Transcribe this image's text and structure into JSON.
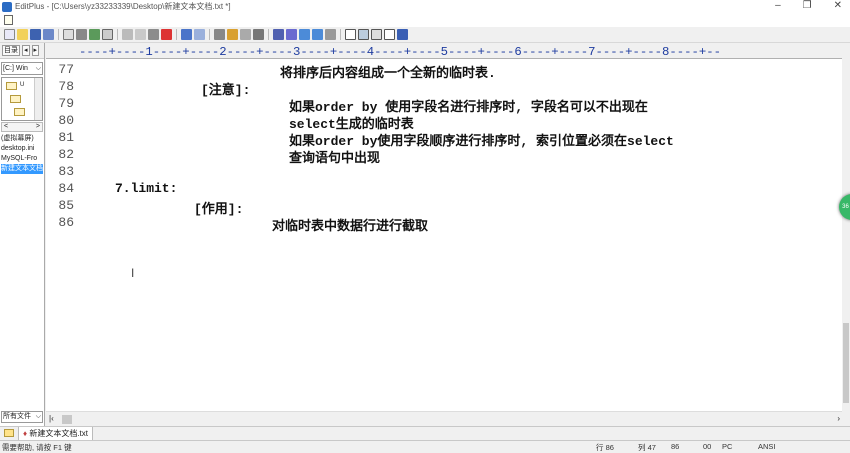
{
  "window": {
    "title": "EditPlus - [C:\\Users\\yz33233339\\Desktop\\新建文本文档.txt *]",
    "minimize": "–",
    "maximize": "❐",
    "close": "✕"
  },
  "sidebar": {
    "tab_label": "目录",
    "tab_prev": "◂",
    "tab_next": "▸",
    "drive": "[C:] Win",
    "tree_items": [
      "U",
      "",
      ""
    ],
    "scroll_left": "<",
    "scroll_right": ">",
    "files": [
      "(虚拟幕屏)",
      "desktop.ini",
      "MySQL-Fro",
      "新建文本文档"
    ],
    "filter": "所有文件"
  },
  "ruler": {
    "text": "----+----1----+----2----+----3----+----4----+----5----+----6----+----7----+----8----+--"
  },
  "editor": {
    "lines": [
      {
        "num": "77",
        "text": "将排序后内容组成一个全新的临时表."
      },
      {
        "num": "78",
        "text": "[注意]:"
      },
      {
        "num": "79",
        "text": "如果order by 使用字段名进行排序时, 字段名可以不出现在"
      },
      {
        "num": "80",
        "text": "select生成的临时表"
      },
      {
        "num": "81",
        "text": "如果order by使用字段顺序进行排序时, 索引位置必须在select"
      },
      {
        "num": "82",
        "text": "查询语句中出现"
      },
      {
        "num": "83",
        "text": ""
      },
      {
        "num": "84",
        "text": "7.limit:"
      },
      {
        "num": "85",
        "text": "[作用]:"
      },
      {
        "num": "86",
        "text": "对临时表中数据行进行截取"
      }
    ],
    "mouse_cursor": "I"
  },
  "side_widget": "36",
  "doc_tab": {
    "marker": "♦",
    "label": "新建文本文档.txt"
  },
  "statusbar": {
    "message": "需要帮助, 请按 F1 键",
    "row": "行 86",
    "col": "列 47",
    "num": "86",
    "code": "00",
    "mode": "PC",
    "encoding": "ANSI"
  }
}
